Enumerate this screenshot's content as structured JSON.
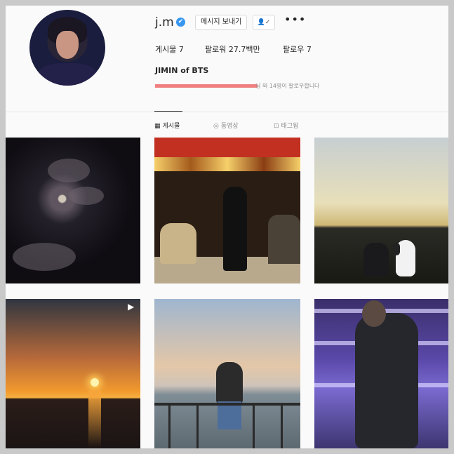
{
  "profile": {
    "username": "j.m",
    "verified_icon": "✔",
    "message_button": "메시지 보내기",
    "follow_icon": "👤✓",
    "more_icon": "•••",
    "posts": "게시물 7",
    "followers": "팔로워 27.7백만",
    "following": "팔로우 7",
    "fullname": "JIMIN of BTS",
    "followed_by": "님 외 14명이 팔로우합니다"
  },
  "tabs": [
    {
      "icon": "▦",
      "label": "게시물"
    },
    {
      "icon": "◎",
      "label": "동영상"
    },
    {
      "icon": "⊡",
      "label": "태그됨"
    }
  ],
  "grid": {
    "video_badge": "▶"
  }
}
